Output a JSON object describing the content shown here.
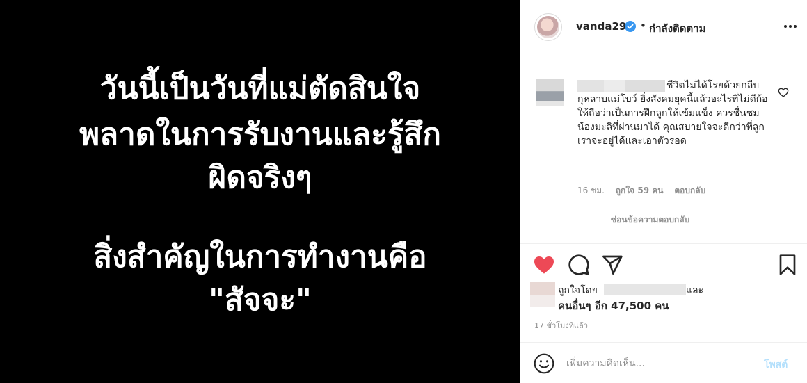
{
  "post": {
    "text_lines": [
      "วันนี้เป็นวันที่แม่ตัดสินใจ",
      "พลาดในการรับงานและรู้สึก",
      "ผิดจริงๆ",
      "สิ่งสำคัญในการทำงานคือ",
      "\"สัจจะ\""
    ]
  },
  "header": {
    "username": "vanda29",
    "separator": "•",
    "follow_status": "กำลังติดตาม",
    "more_icon": "more-horizontal-icon",
    "verified_icon": "verified-badge-icon"
  },
  "comment": {
    "text": "ชีวิตไม่ได้โรยด้วยกลีบกุหลาบแม่โบว์ ยิ่งสังคมยุคนี้แล้วอะไรที่ไม่ดีก้อให้ถือว่าเป็นการฝึกลูกให้เข้มแข็ง ควรชื่นชมน้องมะลิที่ผ่านมาได้ คุณสบายใจจะดีกว่าที่ลูกเราจะอยู่ได้และเอาตัวรอด",
    "time": "16 ชม.",
    "likes": "ถูกใจ 59 คน",
    "reply": "ตอบกลับ",
    "hide_replies": "ซ่อนข้อความตอบกลับ"
  },
  "actions": {
    "like_icon": "heart-filled-icon",
    "comment_icon": "comment-icon",
    "share_icon": "paper-plane-icon",
    "save_icon": "bookmark-icon",
    "like_color": "#ed4956"
  },
  "likes": {
    "liked_by_prefix": "ถูกใจโดย",
    "and": "และ",
    "others": "คนอื่นๆ อีก 47,500 คน"
  },
  "timestamp": "17 ชั่วโมงที่แล้ว",
  "add_comment": {
    "placeholder": "เพิ่มความคิดเห็น...",
    "post_label": "โพสต์",
    "emoji_icon": "emoji-smile-icon"
  }
}
